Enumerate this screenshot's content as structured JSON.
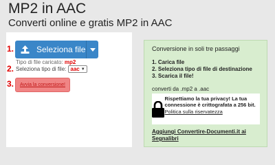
{
  "header": {
    "title": "MP2 in AAC",
    "subtitle": "Converti online e gratis MP2 in AAC"
  },
  "steps_left": {
    "step1": "1.",
    "step2": "2.",
    "step3": "3."
  },
  "upload": {
    "label": "Seleziona file",
    "icon": "upload-icon",
    "dropdown_icon": "caret-down-icon"
  },
  "file_type": {
    "label": "Tipo di file caricato:",
    "value": "mp2"
  },
  "target_type": {
    "label": "Seleziona tipo di file:",
    "selected": "aac"
  },
  "start_button": {
    "label": "Avvia la conversione!"
  },
  "info_panel": {
    "title": "Conversione in soli tre passaggi",
    "steps": [
      "1. Carica file",
      "2. Seleziona tipo di file di destinazione",
      "3. Scarica il file!"
    ],
    "convert_text": "converti da .mp2 a .aac",
    "privacy_text": "Rispettiamo la tua privacy! La tua connessione è crittografata a 256 bit.",
    "privacy_link": "Politica sulla riservatezza",
    "bookmark_link": "Aggiungi Convertire-Documenti.it ai Segnalibri"
  },
  "colors": {
    "primary_button": "#3a86c8",
    "start_button": "#f08585",
    "step_number": "#e00000",
    "info_panel_bg": "#d8edcf"
  }
}
